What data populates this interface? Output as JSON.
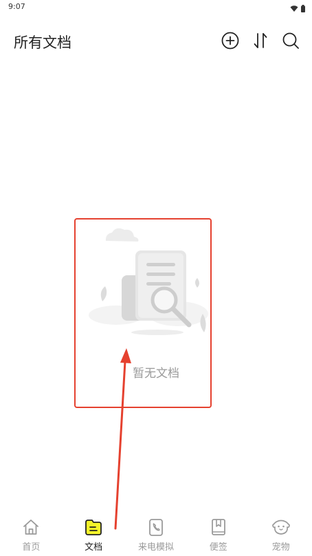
{
  "status_bar": {
    "time": "9:07",
    "icons": [
      "wifi-icon",
      "battery-icon"
    ]
  },
  "header": {
    "title": "所有文档",
    "actions": [
      "add-circle-icon",
      "sort-icon",
      "search-icon"
    ]
  },
  "empty_state": {
    "message": "暂无文档",
    "illustration": "document-search-illustration"
  },
  "annotation": {
    "box_color": "#e5412f",
    "arrow_color": "#e5412f"
  },
  "bottom_nav": {
    "items": [
      {
        "label": "首页",
        "icon": "home-icon",
        "active": false
      },
      {
        "label": "文档",
        "icon": "document-icon",
        "active": true
      },
      {
        "label": "来电模拟",
        "icon": "phone-icon",
        "active": false
      },
      {
        "label": "便签",
        "icon": "notebook-icon",
        "active": false
      },
      {
        "label": "宠物",
        "icon": "pet-icon",
        "active": false
      }
    ],
    "active_color": "#f5f52a"
  }
}
